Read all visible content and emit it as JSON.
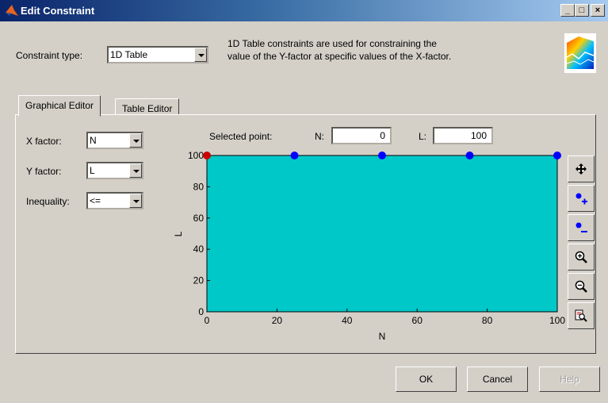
{
  "window": {
    "title": "Edit Constraint",
    "controls": {
      "minimize": "_",
      "maximize": "□",
      "close": "×"
    }
  },
  "constraint": {
    "type_label": "Constraint type:",
    "type_value": "1D Table",
    "description_line1": "1D Table constraints are used for constraining the",
    "description_line2": "value of the Y-factor at specific values of the X-factor."
  },
  "tabs": [
    "Graphical Editor",
    "Table Editor"
  ],
  "factors": {
    "x_label": "X factor:",
    "x_value": "N",
    "y_label": "Y factor:",
    "y_value": "L",
    "inequality_label": "Inequality:",
    "inequality_value": "<="
  },
  "selected_point": {
    "label": "Selected point:",
    "x_name": "N:",
    "x_value": "0",
    "y_name": "L:",
    "y_value": "100"
  },
  "toolbar": [
    "move-icon",
    "add-point-icon",
    "remove-point-icon",
    "zoom-in-icon",
    "zoom-out-icon",
    "zoom-reset-icon"
  ],
  "buttons": {
    "ok": "OK",
    "cancel": "Cancel",
    "help": "Help"
  },
  "colors": {
    "plot_fill": "#00c8c8",
    "point": "#0000ff",
    "selected_point": "#cc0000"
  },
  "chart_data": {
    "type": "scatter",
    "xlabel": "N",
    "ylabel": "L",
    "xlim": [
      0,
      100
    ],
    "ylim": [
      0,
      100
    ],
    "xticks": [
      0,
      20,
      40,
      60,
      80,
      100
    ],
    "yticks": [
      0,
      20,
      40,
      60,
      80,
      100
    ],
    "points": [
      {
        "x": 0,
        "y": 100,
        "selected": true
      },
      {
        "x": 25,
        "y": 100,
        "selected": false
      },
      {
        "x": 50,
        "y": 100,
        "selected": false
      },
      {
        "x": 75,
        "y": 100,
        "selected": false
      },
      {
        "x": 100,
        "y": 100,
        "selected": false
      }
    ]
  }
}
